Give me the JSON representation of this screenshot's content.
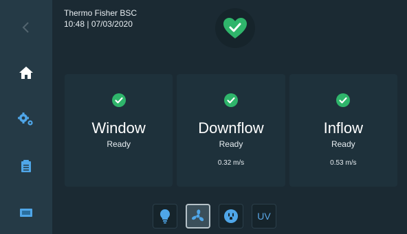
{
  "header": {
    "device_name": "Thermo Fisher BSC",
    "datetime": "10:48 | 07/03/2020"
  },
  "status": {
    "icon": "heart-check-icon",
    "color": "#2fb56b"
  },
  "nav": {
    "items": [
      {
        "id": "back",
        "icon": "chevron-left-icon"
      },
      {
        "id": "home",
        "icon": "home-icon",
        "active": true
      },
      {
        "id": "settings",
        "icon": "gears-icon"
      },
      {
        "id": "log",
        "icon": "clipboard-icon"
      },
      {
        "id": "display",
        "icon": "display-icon"
      }
    ]
  },
  "cards": [
    {
      "title": "Window",
      "status": "Ready",
      "speed": ""
    },
    {
      "title": "Downflow",
      "status": "Ready",
      "speed": "0.32 m/s"
    },
    {
      "title": "Inflow",
      "status": "Ready",
      "speed": "0.53 m/s"
    }
  ],
  "toolbar": {
    "light_icon": "lightbulb-icon",
    "fan_icon": "fan-icon",
    "outlet_icon": "outlet-icon",
    "uv_label": "UV"
  },
  "colors": {
    "accent_blue": "#4fa6e8",
    "check_green": "#2fb56b"
  }
}
